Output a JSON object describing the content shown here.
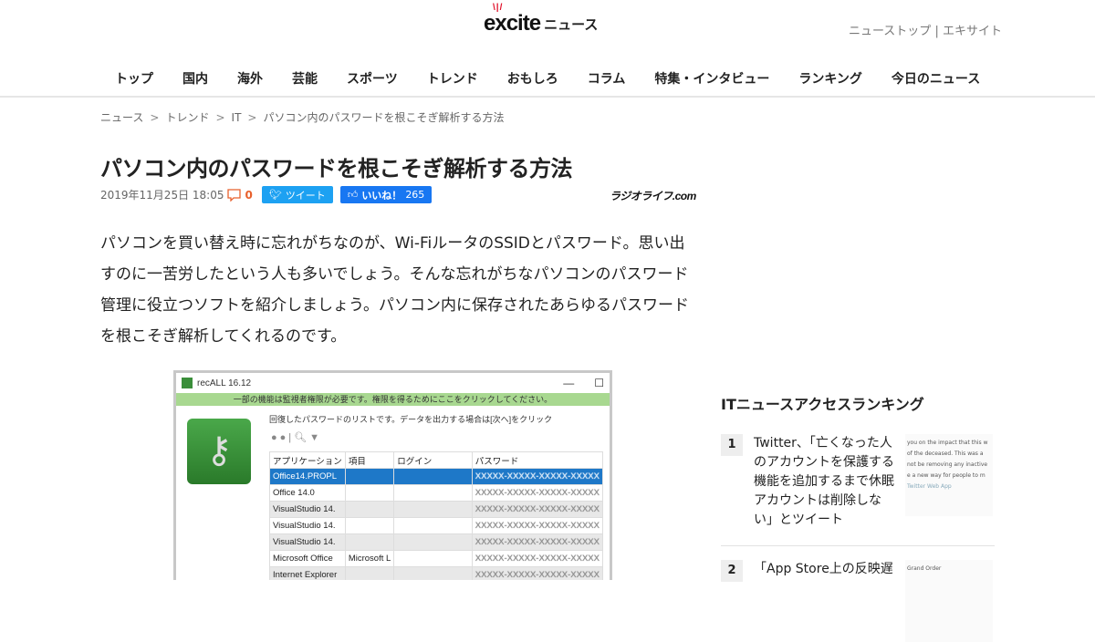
{
  "header": {
    "logo": "excite",
    "logo_suffix": "ニュース",
    "links": [
      "ニューストップ",
      "エキサイト"
    ],
    "link_sep": "|"
  },
  "nav": [
    "トップ",
    "国内",
    "海外",
    "芸能",
    "スポーツ",
    "トレンド",
    "おもしろ",
    "コラム",
    "特集・インタビュー",
    "ランキング",
    "今日のニュース"
  ],
  "breadcrumb": [
    "ニュース",
    "トレンド",
    "IT",
    "パソコン内のパスワードを根こそぎ解析する方法"
  ],
  "breadcrumb_sep": ">",
  "article": {
    "title": "パソコン内のパスワードを根こそぎ解析する方法",
    "date": "2019年11月25日 18:05",
    "comments": "0",
    "tweet_label": "ツイート",
    "like_label": "いいね！",
    "like_count": "265",
    "source": "ラジオライフ.com",
    "body": "パソコンを買い替え時に忘れがちなのが、Wi-FiルータのSSIDとパスワード。思い出すのに一苦労したという人も多いでしょう。そんな忘れがちなパソコンのパスワード管理に役立つソフトを紹介しましょう。パソコン内に保存されたあらゆるパスワードを根こそぎ解析してくれるのです。"
  },
  "screenshot": {
    "window_title": "recALL 16.12",
    "warning": "一部の機能は監視者権限が必要です。権限を得るためにここをクリックしてください。",
    "info": "回復したパスワードのリストです。データを出力する場合は[次へ]をクリック",
    "columns": [
      "アプリケーション",
      "項目",
      "ログイン",
      "パスワード"
    ],
    "rows": [
      {
        "app": "Office14.PROPL",
        "item": "",
        "login": "",
        "password": "XXXXX-XXXXX-XXXXX-XXXXX"
      },
      {
        "app": "Office 14.0",
        "item": "",
        "login": "",
        "password": "XXXXX-XXXXX-XXXXX-XXXXX"
      },
      {
        "app": "VisualStudio 14.",
        "item": "",
        "login": "",
        "password": "XXXXX-XXXXX-XXXXX-XXXXX"
      },
      {
        "app": "VisualStudio 14.",
        "item": "",
        "login": "",
        "password": "XXXXX-XXXXX-XXXXX-XXXXX"
      },
      {
        "app": "VisualStudio 14.",
        "item": "",
        "login": "",
        "password": "XXXXX-XXXXX-XXXXX-XXXXX"
      },
      {
        "app": "Microsoft Office",
        "item": "Microsoft L",
        "login": "",
        "password": "XXXXX-XXXXX-XXXXX-XXXXX"
      },
      {
        "app": "Internet Explorer",
        "item": "",
        "login": "",
        "password": "XXXXX-XXXXX-XXXXX-XXXXX"
      }
    ]
  },
  "ranking": {
    "title": "ITニュースアクセスランキング",
    "items": [
      {
        "rank": "1",
        "text": "Twitter、「亡くなった人のアカウントを保護する機能を追加するまで休眠アカウントは削除しない」とツイート",
        "thumb": [
          "you on the impact that this w",
          "of the deceased. This was a",
          "not be removing any inactive",
          "e a new way for people to m",
          "Twitter Web App"
        ]
      },
      {
        "rank": "2",
        "text": "「App Store上の反映遅",
        "thumb": [
          "Grand Order"
        ]
      }
    ]
  }
}
